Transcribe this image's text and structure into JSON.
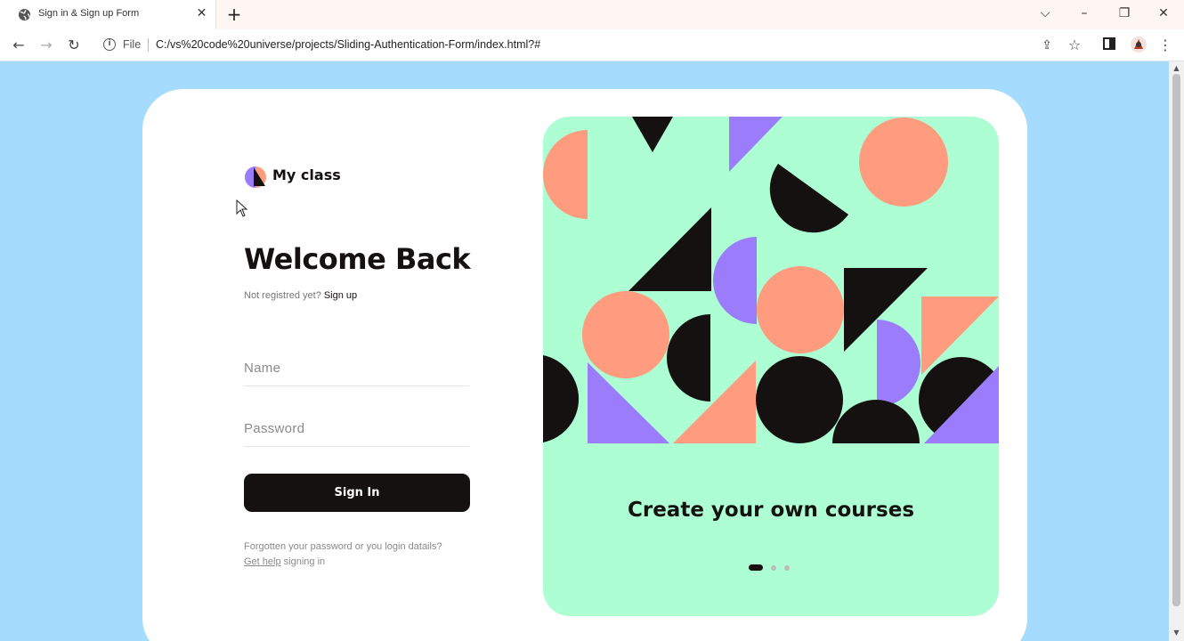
{
  "browser": {
    "tab_title": "Sign in & Sign up Form",
    "url_scheme_label": "File",
    "url": "C:/vs%20code%20universe/projects/Sliding-Authentication-Form/index.html?#"
  },
  "page": {
    "brand": "My class",
    "heading": "Welcome Back",
    "subline_text": "Not registred yet?",
    "subline_link": "Sign up",
    "name_placeholder": "Name",
    "password_placeholder": "Password",
    "signin_label": "Sign In",
    "forgot_text": "Forgotten your password or you login datails?",
    "help_link": "Get help",
    "help_suffix": "signing in",
    "tagline": "Create your own courses",
    "carousel_active_index": 0,
    "carousel_count": 3
  },
  "colors": {
    "page_bg": "#a5dcfd",
    "panel_bg": "#adfed3",
    "dark": "#151111",
    "coral": "#ff9b7e",
    "purple": "#9b7dfc"
  }
}
